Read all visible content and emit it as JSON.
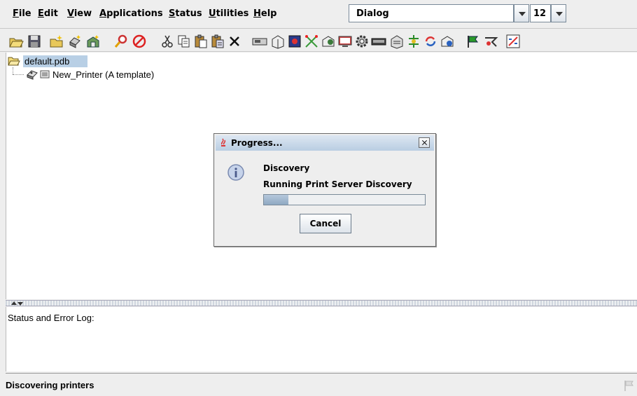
{
  "menubar": {
    "items": [
      {
        "mnemonic": "F",
        "rest": "ile"
      },
      {
        "mnemonic": "E",
        "rest": "dit"
      },
      {
        "mnemonic": "V",
        "rest": "iew"
      },
      {
        "mnemonic": "A",
        "rest": "pplications"
      },
      {
        "mnemonic": "S",
        "rest": "tatus"
      },
      {
        "mnemonic": "U",
        "rest": "tilities"
      },
      {
        "mnemonic": "H",
        "rest": "elp"
      }
    ]
  },
  "font_selector": {
    "family": "Dialog",
    "size": "12"
  },
  "toolbar": {
    "icons": [
      "open-icon",
      "save-icon",
      "new-folder-icon",
      "new-printer-icon",
      "new-device-icon",
      "find-icon",
      "stop-icon",
      "cut-icon",
      "copy-icon",
      "paste-icon",
      "paste-special-icon",
      "delete-icon",
      "network-card-icon",
      "printer-info-icon",
      "book-icon",
      "tools-icon",
      "settings-icon",
      "monitor-icon",
      "gear-icon",
      "rack-icon",
      "printer-queue-icon",
      "connect-icon",
      "refresh-icon",
      "device-status-icon",
      "flag-icon",
      "tune-icon",
      "stats-icon"
    ]
  },
  "tree": {
    "root_label": "default.pdb",
    "child_label": "New_Printer (A template)"
  },
  "log": {
    "label": "Status and Error Log:"
  },
  "status_bar": {
    "text": "Discovering printers"
  },
  "dialog": {
    "title": "Progress...",
    "heading": "Discovery",
    "message": "Running Print Server Discovery",
    "progress": 0.15,
    "cancel_label": "Cancel"
  },
  "colors": {
    "selection": "#b8cfe5",
    "progress": "#8fa8c2",
    "title_bar": "#b9cde2"
  }
}
